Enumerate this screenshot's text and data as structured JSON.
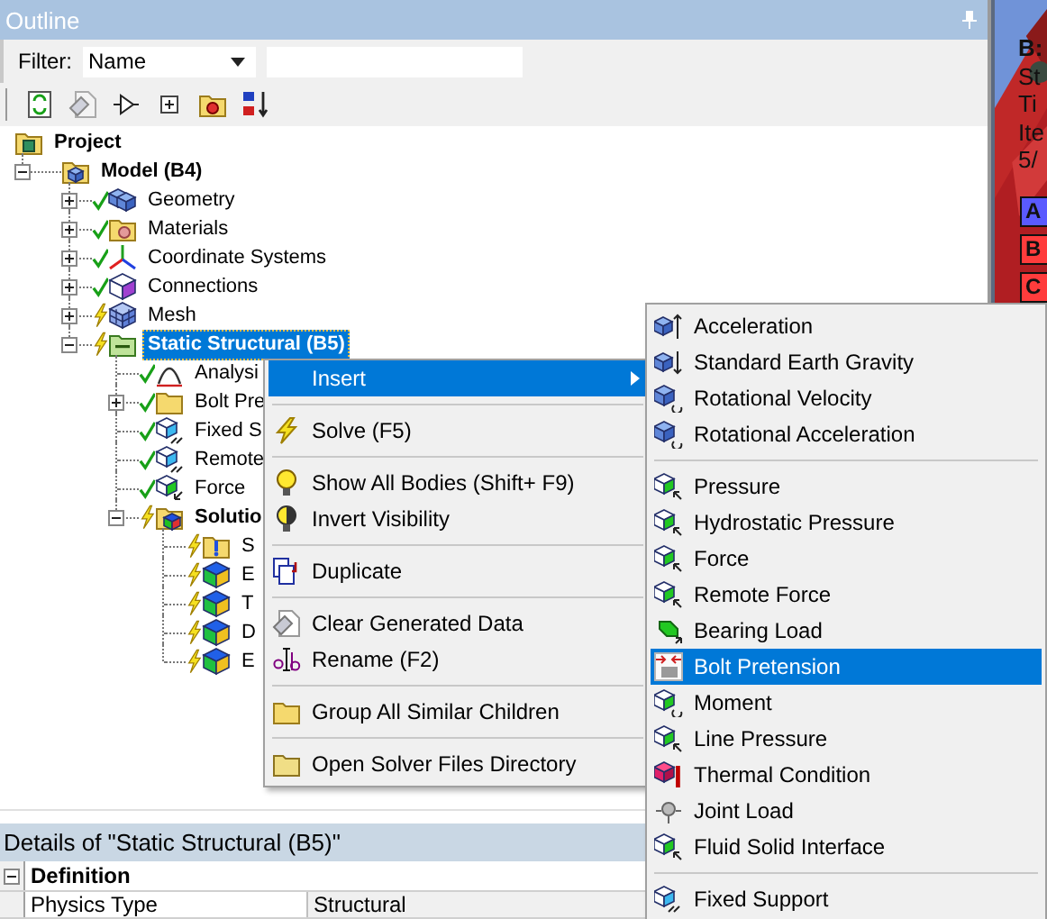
{
  "outline": {
    "title": "Outline",
    "filter": {
      "label": "Filter:",
      "value": "Name"
    },
    "tree": [
      {
        "label": "Project",
        "bold": true,
        "kind": "project",
        "selected": false,
        "children": [
          {
            "label": "Model (B4)",
            "bold": true,
            "kind": "model",
            "expanded": true,
            "selected": false,
            "children": [
              {
                "label": "Geometry",
                "kind": "geometry",
                "expanded": false,
                "solved": true,
                "selected": false
              },
              {
                "label": "Materials",
                "kind": "materials",
                "expanded": false,
                "solved": true,
                "selected": false
              },
              {
                "label": "Coordinate Systems",
                "kind": "coords",
                "expanded": false,
                "solved": true,
                "selected": false
              },
              {
                "label": "Connections",
                "kind": "connections",
                "expanded": false,
                "solved": true,
                "selected": false
              },
              {
                "label": "Mesh",
                "kind": "mesh",
                "expanded": false,
                "solved": false,
                "selected": false
              },
              {
                "label": "Static Structural (B5)",
                "bold": true,
                "kind": "analysis-folder",
                "expanded": true,
                "solved": false,
                "selected": true,
                "children": [
                  {
                    "label": "Analysi",
                    "kind": "analysis",
                    "solved": true,
                    "selected": false
                  },
                  {
                    "label": "Bolt Pre",
                    "kind": "folder",
                    "expanded": false,
                    "solved": true,
                    "selected": false
                  },
                  {
                    "label": "Fixed S",
                    "kind": "support",
                    "solved": true,
                    "selected": false
                  },
                  {
                    "label": "Remote",
                    "kind": "support",
                    "solved": true,
                    "selected": false
                  },
                  {
                    "label": "Force",
                    "kind": "load",
                    "solved": true,
                    "selected": false
                  },
                  {
                    "label": "Solutio",
                    "bold": true,
                    "kind": "solution",
                    "expanded": true,
                    "solved": false,
                    "selected": false,
                    "children": [
                      {
                        "label": "S",
                        "kind": "info",
                        "solved": false,
                        "selected": false
                      },
                      {
                        "label": "E",
                        "kind": "result",
                        "solved": false,
                        "selected": false
                      },
                      {
                        "label": "T",
                        "kind": "result",
                        "solved": false,
                        "selected": false
                      },
                      {
                        "label": "D",
                        "kind": "result",
                        "solved": false,
                        "selected": false
                      },
                      {
                        "label": "E",
                        "kind": "result",
                        "solved": false,
                        "selected": false
                      }
                    ]
                  }
                ]
              }
            ]
          }
        ]
      }
    ]
  },
  "viewport": {
    "title": "B:",
    "lines": [
      "St",
      "Ti",
      "Ite",
      "5/"
    ],
    "legend": [
      {
        "label": "A",
        "color": "#5a5aff"
      },
      {
        "label": "B",
        "color": "#ff3c3c"
      },
      {
        "label": "C",
        "color": "#ff3c3c"
      }
    ]
  },
  "details": {
    "title": "Details of \"Static Structural (B5)\"",
    "sections": [
      {
        "label": "Definition",
        "expanded": true,
        "rows": [
          {
            "name": "Physics Type",
            "value": "Structural"
          }
        ]
      }
    ]
  },
  "context_menu": {
    "groups": [
      [
        {
          "label": "Insert",
          "kind": "submenu",
          "selected": true
        }
      ],
      [
        {
          "label": "Solve (F5)",
          "kind": "solve",
          "selected": false
        }
      ],
      [
        {
          "label": "Show All Bodies (Shift+ F9)",
          "kind": "bulb",
          "selected": false
        },
        {
          "label": "Invert Visibility",
          "kind": "invert",
          "selected": false
        }
      ],
      [
        {
          "label": "Duplicate",
          "kind": "duplicate",
          "selected": false
        }
      ],
      [
        {
          "label": "Clear Generated Data",
          "kind": "clear",
          "selected": false
        },
        {
          "label": "Rename (F2)",
          "kind": "rename",
          "selected": false
        }
      ],
      [
        {
          "label": "Group All Similar Children",
          "kind": "group",
          "selected": false
        }
      ],
      [
        {
          "label": "Open Solver Files Directory",
          "kind": "open",
          "selected": false
        }
      ]
    ]
  },
  "insert_menu": {
    "groups": [
      [
        {
          "label": "Acceleration",
          "kind": "accel",
          "selected": false
        },
        {
          "label": "Standard Earth Gravity",
          "kind": "gravity",
          "selected": false
        },
        {
          "label": "Rotational Velocity",
          "kind": "rot-vel",
          "selected": false
        },
        {
          "label": "Rotational Acceleration",
          "kind": "rot-acc",
          "selected": false
        }
      ],
      [
        {
          "label": "Pressure",
          "kind": "load-cube",
          "selected": false
        },
        {
          "label": "Hydrostatic Pressure",
          "kind": "load-cube",
          "selected": false
        },
        {
          "label": "Force",
          "kind": "load-cube",
          "selected": false
        },
        {
          "label": "Remote Force",
          "kind": "load-cube",
          "selected": false
        },
        {
          "label": "Bearing Load",
          "kind": "bearing",
          "selected": false
        },
        {
          "label": "Bolt Pretension",
          "kind": "bolt",
          "selected": true
        },
        {
          "label": "Moment",
          "kind": "moment",
          "selected": false
        },
        {
          "label": "Line Pressure",
          "kind": "load-cube",
          "selected": false
        },
        {
          "label": "Thermal Condition",
          "kind": "thermal",
          "selected": false
        },
        {
          "label": "Joint Load",
          "kind": "joint",
          "selected": false
        },
        {
          "label": "Fluid Solid Interface",
          "kind": "load-cube",
          "selected": false
        }
      ],
      [
        {
          "label": "Fixed Support",
          "kind": "fixed",
          "selected": false
        }
      ]
    ]
  }
}
